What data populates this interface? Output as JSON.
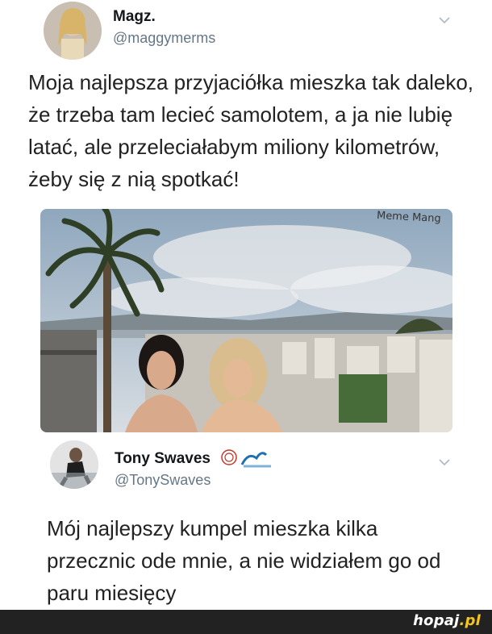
{
  "tweet1": {
    "name": "Magz.",
    "handle": "@maggymerms",
    "text": "Moja najlepsza przyjaciółka mieszka tak daleko, że trzeba tam lecieć samolotem, a ja nie lubię latać, ale przeleciałabym miliony kilometrów, żeby się z nią spotkać!",
    "icons": [
      "avatar",
      "chevron-down-icon"
    ]
  },
  "photo": {
    "watermark": "Meme Mang"
  },
  "tweet2": {
    "name": "Tony Swaves",
    "handle": "@TonySwaves",
    "text": "Mój najlepszy kumpel mieszka kilka przecznic ode mnie, a nie widziałem go od paru miesięcy",
    "icons": [
      "avatar",
      "badge-icon",
      "wave-emoji-icon",
      "chevron-down-icon"
    ]
  },
  "footer": {
    "brand": "hopaj",
    "tld": ".pl"
  },
  "colors": {
    "handle": "#657786",
    "footer_bg": "#222222",
    "brand_accent": "#f5c518"
  }
}
